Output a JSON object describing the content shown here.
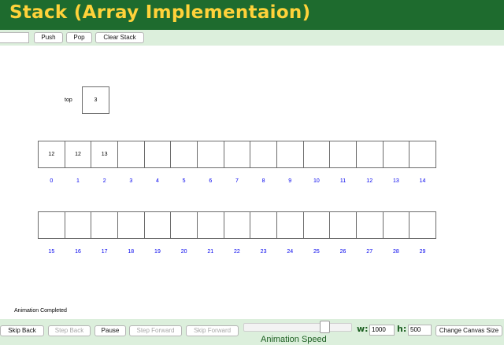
{
  "header": {
    "title": "Stack (Array Implementaion)"
  },
  "toolbar": {
    "input_value": "",
    "push_label": "Push",
    "pop_label": "Pop",
    "clear_label": "Clear Stack"
  },
  "stack": {
    "top_label": "top",
    "top_value": "3",
    "row1": {
      "cells": [
        "12",
        "12",
        "13",
        "",
        "",
        "",
        "",
        "",
        "",
        "",
        "",
        "",
        "",
        "",
        ""
      ],
      "indices": [
        "0",
        "1",
        "2",
        "3",
        "4",
        "5",
        "6",
        "7",
        "8",
        "9",
        "10",
        "11",
        "12",
        "13",
        "14"
      ]
    },
    "row2": {
      "cells": [
        "",
        "",
        "",
        "",
        "",
        "",
        "",
        "",
        "",
        "",
        "",
        "",
        "",
        "",
        ""
      ],
      "indices": [
        "15",
        "16",
        "17",
        "18",
        "19",
        "20",
        "21",
        "22",
        "23",
        "24",
        "25",
        "26",
        "27",
        "28",
        "29"
      ]
    }
  },
  "status": {
    "message": "Animation Completed"
  },
  "controls": {
    "skip_back": "Skip Back",
    "step_back": "Step Back",
    "pause": "Pause",
    "step_forward": "Step Forward",
    "skip_forward": "Skip Forward",
    "speed_label": "Animation Speed",
    "w_label": "w:",
    "w_value": "1000",
    "h_label": "h:",
    "h_value": "500",
    "change_canvas": "Change Canvas Size"
  },
  "colors": {
    "header_bg": "#1e6b2e",
    "title": "#ffd23a",
    "toolbar_bg": "#dcefdc",
    "index_text": "#0000ee"
  }
}
